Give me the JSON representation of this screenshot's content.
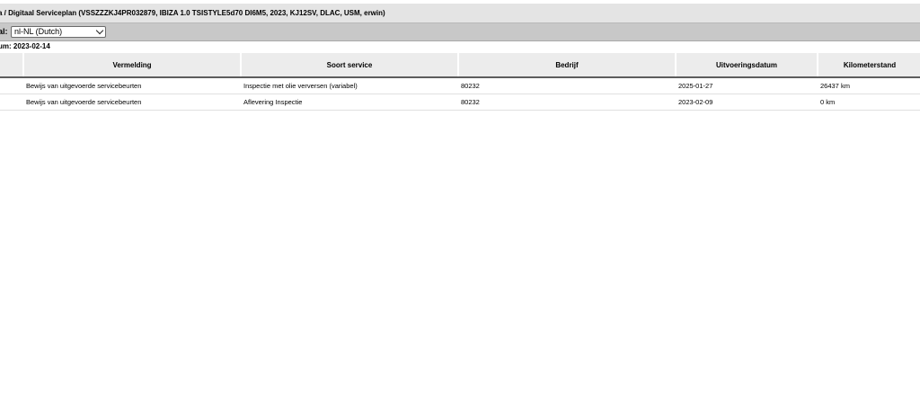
{
  "header": {
    "breadcrumb": "a / Digitaal Serviceplan (VSSZZZKJ4PR032879, IBIZA 1.0 TSISTYLE5d70 DI6M5, 2023, KJ12SV, DLAC, USM, erwin)"
  },
  "language": {
    "label": "al:",
    "selected": "nl-NL (Dutch)"
  },
  "date_line": "um: 2023-02-14",
  "table": {
    "columns": [
      "",
      "Vermelding",
      "Soort service",
      "Bedrijf",
      "Uitvoeringsdatum",
      "Kilometerstand"
    ],
    "rows": [
      [
        "",
        "Bewijs van uitgevoerde servicebeurten",
        "Inspectie met olie verversen (variabel)",
        "80232",
        "2025-01-27",
        "26437 km"
      ],
      [
        "",
        "Bewijs van uitgevoerde servicebeurten",
        "Aflevering Inspectie",
        "80232",
        "2023-02-09",
        "0 km"
      ]
    ]
  }
}
